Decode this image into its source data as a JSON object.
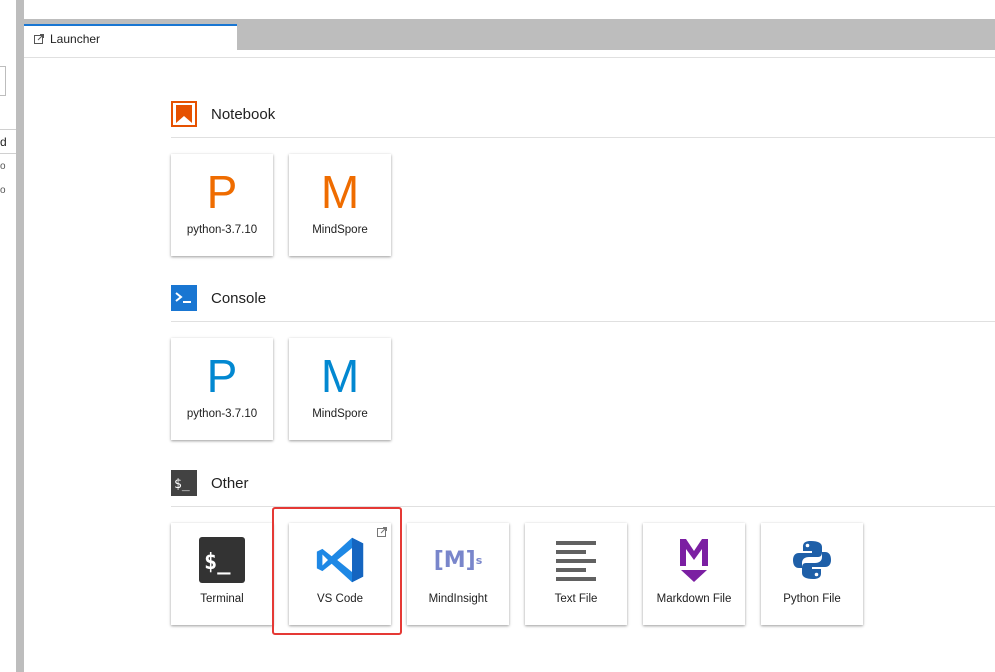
{
  "side_panel": {
    "header_fragment": "d",
    "row_fragments": [
      "o",
      "o"
    ]
  },
  "tab": {
    "label": "Launcher",
    "icon": "launcher-icon"
  },
  "sections": {
    "notebook": {
      "title": "Notebook",
      "icon": "notebook-icon",
      "icon_color": "#e65100",
      "cards": [
        {
          "letter": "P",
          "label": "python-3.7.10",
          "color": "#ef6c00"
        },
        {
          "letter": "M",
          "label": "MindSpore",
          "color": "#ef6c00"
        }
      ]
    },
    "console": {
      "title": "Console",
      "icon": "console-icon",
      "icon_color": "#1976d2",
      "cards": [
        {
          "letter": "P",
          "label": "python-3.7.10",
          "color": "#0288d1"
        },
        {
          "letter": "M",
          "label": "MindSpore",
          "color": "#0288d1"
        }
      ]
    },
    "other": {
      "title": "Other",
      "icon": "terminal-prompt-icon",
      "icon_color": "#424242",
      "cards": [
        {
          "label": "Terminal",
          "icon": "terminal-icon"
        },
        {
          "label": "VS Code",
          "icon": "vscode-icon"
        },
        {
          "label": "MindInsight",
          "icon": "mindinsight-icon",
          "icon_text": "[M]",
          "icon_sup": "s"
        },
        {
          "label": "Text File",
          "icon": "text-file-icon"
        },
        {
          "label": "Markdown File",
          "icon": "markdown-icon"
        },
        {
          "label": "Python File",
          "icon": "python-icon"
        }
      ]
    }
  },
  "colors": {
    "highlight": "#e53935",
    "tab_accent": "#1976d2",
    "mindinsight": "#7986cb",
    "markdown": "#7b1fa2",
    "python_blue": "#1e5fa8",
    "vscode_blue": "#1e88e5"
  }
}
